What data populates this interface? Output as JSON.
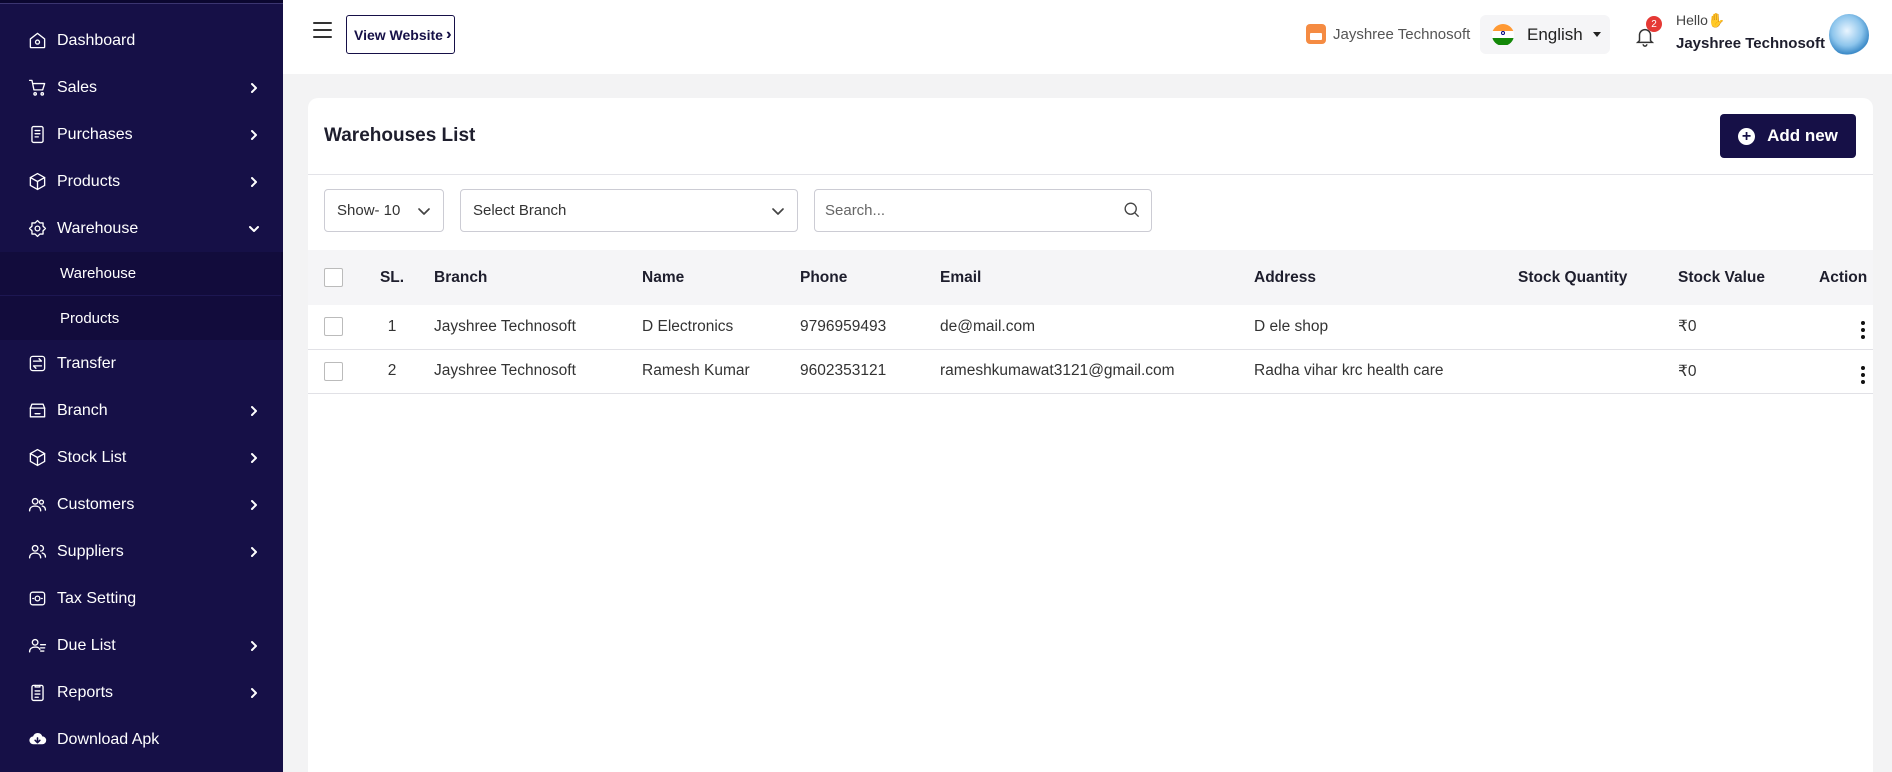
{
  "sidebar": {
    "items": [
      {
        "label": "Dashboard",
        "icon": "home-icon",
        "has_chevron": false
      },
      {
        "label": "Sales",
        "icon": "cart-icon",
        "has_chevron": true
      },
      {
        "label": "Purchases",
        "icon": "receipt-icon",
        "has_chevron": true
      },
      {
        "label": "Products",
        "icon": "box-icon",
        "has_chevron": true
      },
      {
        "label": "Warehouse",
        "icon": "warehouse-icon",
        "has_chevron": true,
        "expanded": true
      },
      {
        "label": "Transfer",
        "icon": "transfer-icon",
        "has_chevron": false
      },
      {
        "label": "Branch",
        "icon": "branch-icon",
        "has_chevron": true
      },
      {
        "label": "Stock List",
        "icon": "stock-icon",
        "has_chevron": true
      },
      {
        "label": "Customers",
        "icon": "customers-icon",
        "has_chevron": true
      },
      {
        "label": "Suppliers",
        "icon": "suppliers-icon",
        "has_chevron": true
      },
      {
        "label": "Tax Setting",
        "icon": "tax-icon",
        "has_chevron": false
      },
      {
        "label": "Due List",
        "icon": "due-list-icon",
        "has_chevron": true
      },
      {
        "label": "Reports",
        "icon": "reports-icon",
        "has_chevron": true
      },
      {
        "label": "Download Apk",
        "icon": "cloud-download-icon",
        "has_chevron": false
      }
    ],
    "warehouse_sub": [
      "Warehouse",
      "Products"
    ]
  },
  "topbar": {
    "view_website": "View Website",
    "store_name": "Jayshree Technosoft",
    "language": "English",
    "notification_count": "2",
    "hello": "Hello",
    "user_name": "Jayshree Technosoft"
  },
  "page": {
    "title": "Warehouses List",
    "add_new": "Add new",
    "show_select": "Show- 10",
    "branch_select": "Select Branch",
    "search_placeholder": "Search..."
  },
  "table": {
    "headers": [
      "SL.",
      "Branch",
      "Name",
      "Phone",
      "Email",
      "Address",
      "Stock Quantity",
      "Stock Value",
      "Action"
    ],
    "rows": [
      {
        "sl": "1",
        "branch": "Jayshree Technosoft",
        "name": "D Electronics",
        "phone": "9796959493",
        "email": "de@mail.com",
        "address": "D ele shop",
        "stock_quantity": "",
        "stock_value": "₹0"
      },
      {
        "sl": "2",
        "branch": "Jayshree Technosoft",
        "name": "Ramesh Kumar",
        "phone": "9602353121",
        "email": "rameshkumawat3121@gmail.com",
        "address": "Radha vihar krc health care",
        "stock_quantity": "",
        "stock_value": "₹0"
      }
    ]
  },
  "colors": {
    "sidebar_bg": "#161047",
    "primary": "#161047",
    "badge": "#e53935",
    "store_icon": "#f58b42"
  }
}
